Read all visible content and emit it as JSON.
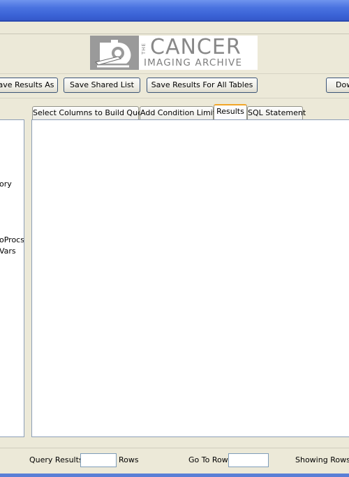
{
  "logo": {
    "the": "THE",
    "cancer": "CANCER",
    "archive": "IMAGING ARCHIVE"
  },
  "toolbar": {
    "save_results_as": "ave Results As",
    "save_shared_list": "Save Shared List",
    "save_results_all_tables": "Save Results For All Tables",
    "download": "Dow"
  },
  "tabs": [
    {
      "label": "Select Columns to Build Query",
      "active": false
    },
    {
      "label": "Add Condition Limits",
      "active": false
    },
    {
      "label": "Results",
      "active": true
    },
    {
      "label": "SQL Statement",
      "active": false
    }
  ],
  "tree": {
    "items": [
      "ory",
      "oProcs",
      "Vars"
    ]
  },
  "footer": {
    "query_results_label": "Query Results",
    "query_results_value": "",
    "rows_label": "Rows",
    "go_to_row_label": "Go To Row",
    "go_to_row_value": "",
    "showing_rows_label": "Showing Rows:"
  },
  "colors": {
    "title_bar": "#3b63d6",
    "window_bg": "#ece9d8",
    "active_tab_accent": "#f2a628",
    "panel_border": "#8c9eb8"
  }
}
